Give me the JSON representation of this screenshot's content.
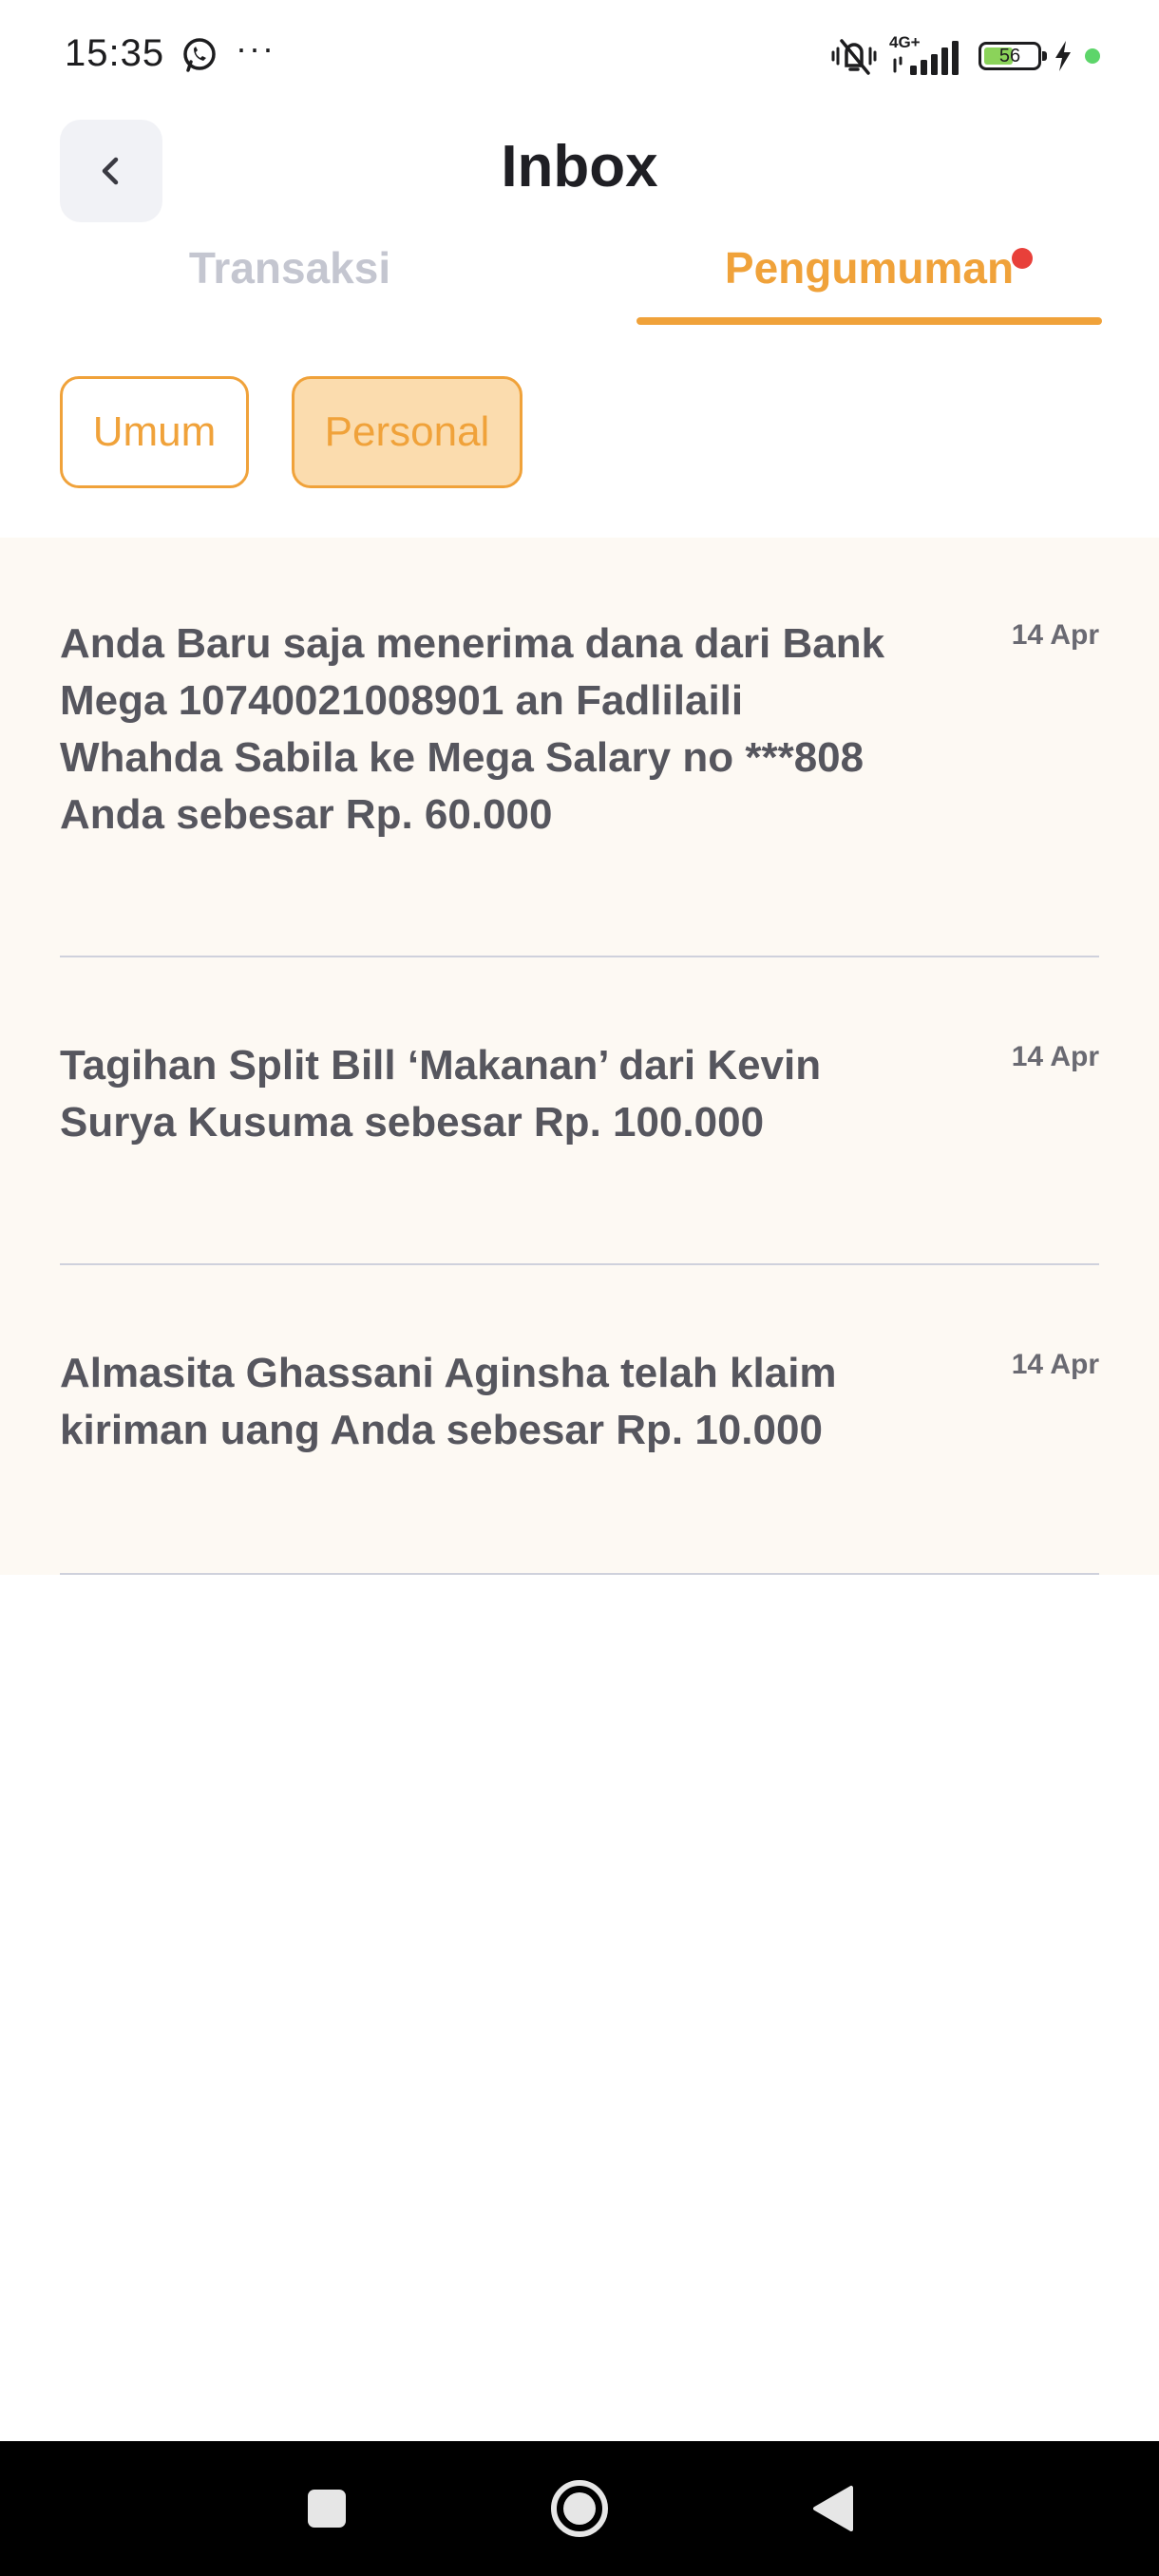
{
  "status_bar": {
    "time": "15:35",
    "more_dots": "···",
    "network": "4G+",
    "battery_level": "56",
    "battery_fraction": 0.56
  },
  "header": {
    "title": "Inbox"
  },
  "tabs": [
    {
      "label": "Transaksi",
      "active": false
    },
    {
      "label": "Pengumuman",
      "active": true,
      "has_notification": true
    }
  ],
  "filters": [
    {
      "label": "Umum",
      "selected": false
    },
    {
      "label": "Personal",
      "selected": true
    }
  ],
  "messages": [
    {
      "text": "Anda Baru saja menerima dana dari Bank Mega 10740021008901 an Fadlilaili Whahda Sabila ke Mega Salary no ***808 Anda sebesar Rp. 60.000",
      "date": "14 Apr"
    },
    {
      "text": "Tagihan Split Bill ‘Makanan’ dari Kevin Surya Kusuma sebesar Rp. 100.000",
      "date": "14 Apr"
    },
    {
      "text": "Almasita Ghassani Aginsha telah klaim kiriman uang Anda sebesar Rp. 10.000",
      "date": "14 Apr"
    }
  ],
  "colors": {
    "accent": "#f0a23a",
    "chip_selected_bg": "#fbdcae",
    "list_bg": "#fdf9f3",
    "inactive_tab": "#c4c6d0",
    "notification": "#e8403a"
  },
  "icons": {
    "back": "chevron-left-icon",
    "nav_recents": "square-icon",
    "nav_home": "circle-icon",
    "nav_back": "triangle-back-icon"
  }
}
